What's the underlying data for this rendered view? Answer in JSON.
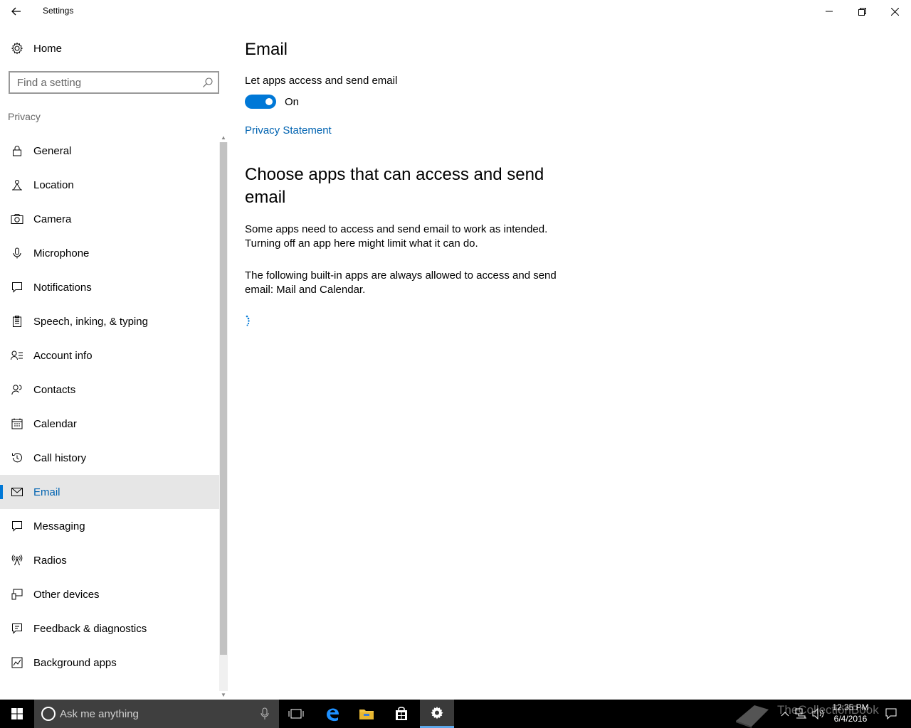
{
  "window": {
    "title": "Settings",
    "controls": [
      "minimize-icon",
      "restore-icon",
      "close-icon"
    ]
  },
  "sidebar": {
    "home_label": "Home",
    "search_placeholder": "Find a setting",
    "section_label": "Privacy",
    "items": [
      {
        "label": "General",
        "icon": "lock-icon"
      },
      {
        "label": "Location",
        "icon": "location-icon"
      },
      {
        "label": "Camera",
        "icon": "camera-icon"
      },
      {
        "label": "Microphone",
        "icon": "microphone-icon"
      },
      {
        "label": "Notifications",
        "icon": "notifications-icon"
      },
      {
        "label": "Speech, inking, & typing",
        "icon": "speech-icon"
      },
      {
        "label": "Account info",
        "icon": "account-icon"
      },
      {
        "label": "Contacts",
        "icon": "contacts-icon"
      },
      {
        "label": "Calendar",
        "icon": "calendar-icon"
      },
      {
        "label": "Call history",
        "icon": "history-icon"
      },
      {
        "label": "Email",
        "icon": "mail-icon",
        "selected": true
      },
      {
        "label": "Messaging",
        "icon": "message-icon"
      },
      {
        "label": "Radios",
        "icon": "radio-icon"
      },
      {
        "label": "Other devices",
        "icon": "devices-icon"
      },
      {
        "label": "Feedback & diagnostics",
        "icon": "feedback-icon"
      },
      {
        "label": "Background apps",
        "icon": "background-apps-icon"
      }
    ]
  },
  "main": {
    "title": "Email",
    "toggle_label": "Let apps access and send email",
    "toggle_state": "On",
    "toggle_on": true,
    "privacy_link": "Privacy Statement",
    "subheading": "Choose apps that can access and send email",
    "description": "Some apps need to access and send email to work as intended. Turning off an app here might limit what it can do.",
    "builtin_note": "The following built-in apps are always allowed to access and send email: Mail and Calendar."
  },
  "taskbar": {
    "search_placeholder": "Ask me anything",
    "clock_time": "12:35 PM",
    "clock_date": "6/4/2016",
    "watermark": "TheCollectionBook"
  },
  "colors": {
    "accent": "#0078d7",
    "link": "#0063b1",
    "selected_bg": "#e6e6e6",
    "taskbar": "#000000"
  }
}
